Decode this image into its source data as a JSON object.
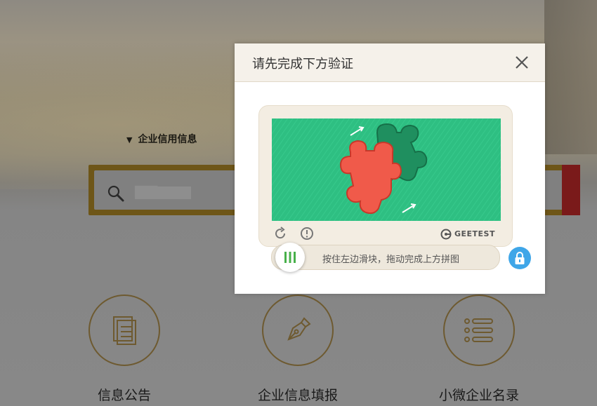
{
  "background": {
    "category_label": "企业信用信息",
    "search_value": "███"
  },
  "features": [
    {
      "label": "信息公告",
      "icon": "document-icon"
    },
    {
      "label": "企业信息填报",
      "icon": "pen-icon"
    },
    {
      "label": "小微企业名录",
      "icon": "list-icon"
    }
  ],
  "dialog": {
    "title": "请先完成下方验证",
    "close_icon": "close-icon",
    "captcha": {
      "brand": "GEETEST",
      "slider_hint": "按住左边滑块，拖动完成上方拼图",
      "colors": {
        "puzzle_bg": "#2ebf82",
        "piece": "#f05a4a",
        "hole": "#1f8f5f",
        "lock": "#3fa6e8"
      }
    }
  }
}
